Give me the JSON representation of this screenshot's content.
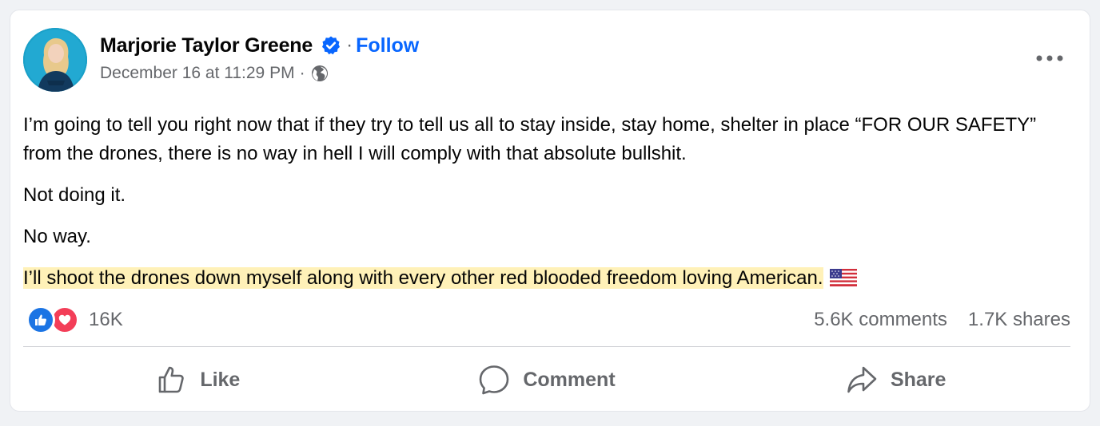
{
  "post": {
    "author": "Marjorie Taylor Greene",
    "follow_label": "Follow",
    "separator": "·",
    "timestamp": "December 16 at 11:29 PM",
    "meta_separator": "·",
    "paragraphs": [
      "I’m going to tell you right now that if they try to tell us all to stay inside, stay home, shelter in place “FOR OUR SAFETY” from the drones, there is no way in hell I will comply with that absolute bullshit.",
      "Not doing it.",
      "No way."
    ],
    "highlighted_paragraph": "I’ll shoot the drones down myself along with every other red blooded freedom loving American.",
    "trailing_emoji": "us-flag-icon"
  },
  "engagement": {
    "reaction_count": "16K",
    "comments": "5.6K comments",
    "shares": "1.7K shares",
    "reaction_types": [
      "like",
      "love"
    ]
  },
  "actions": {
    "like_label": "Like",
    "comment_label": "Comment",
    "share_label": "Share"
  },
  "icons": {
    "verified": "verified-badge-icon",
    "audience": "globe-icon",
    "more": "more-options-icon"
  },
  "colors": {
    "link": "#0866ff",
    "secondary_text": "#65676b",
    "highlight": "#fff1b8",
    "like_reaction": "#1b74e4",
    "love_reaction": "#f33e58"
  }
}
